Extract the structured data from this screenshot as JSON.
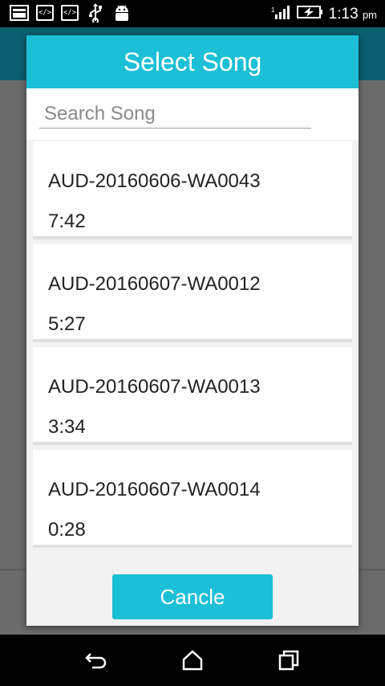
{
  "status_bar": {
    "time": "1:13",
    "ampm": "pm",
    "icons": [
      "image-icon",
      "code-icon",
      "code-icon",
      "usb-icon",
      "android-icon",
      "signal-icon",
      "battery-charging-icon"
    ]
  },
  "dialog": {
    "title": "Select Song",
    "search": {
      "placeholder": "Search Song",
      "value": ""
    },
    "songs": [
      {
        "title": "AUD-20160606-WA0043",
        "duration": "7:42"
      },
      {
        "title": "AUD-20160607-WA0012",
        "duration": "5:27"
      },
      {
        "title": "AUD-20160607-WA0013",
        "duration": "3:34"
      },
      {
        "title": "AUD-20160607-WA0014",
        "duration": "0:28"
      }
    ],
    "cancel_label": "Cancle"
  },
  "nav_bar": {
    "buttons": [
      "back-icon",
      "home-icon",
      "recents-icon"
    ]
  },
  "colors": {
    "accent": "#1cbfd6",
    "app_toolbar": "#0a5f6e",
    "scrim": "#6b6b6b"
  }
}
